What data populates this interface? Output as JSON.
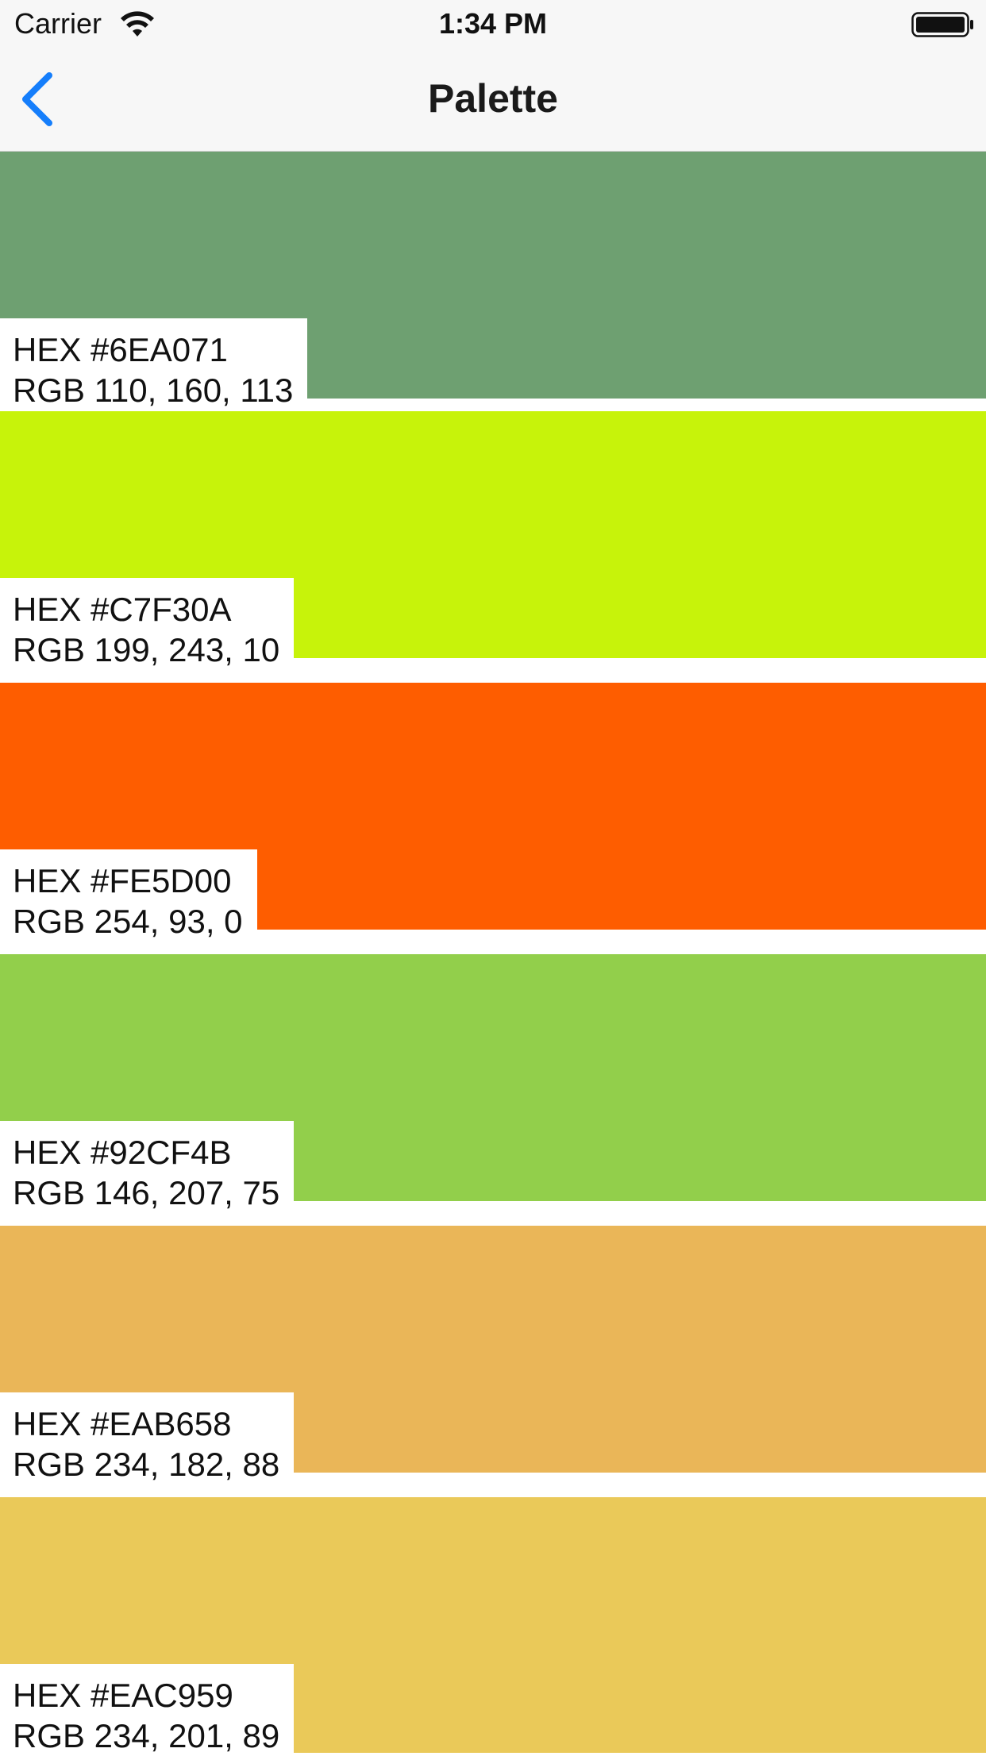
{
  "status_bar": {
    "carrier": "Carrier",
    "time": "1:34 PM",
    "wifi_icon": "wifi-icon",
    "battery_icon": "battery-icon"
  },
  "nav": {
    "title": "Palette",
    "back_icon": "chevron-left-icon",
    "accent_color": "#157efb"
  },
  "colors": [
    {
      "hex_label": "HEX #6EA071",
      "rgb_label": "RGB 110, 160, 113",
      "color": "#6EA071"
    },
    {
      "hex_label": "HEX #C7F30A",
      "rgb_label": "RGB 199, 243, 10",
      "color": "#C7F30A"
    },
    {
      "hex_label": "HEX #FE5D00",
      "rgb_label": "RGB 254, 93, 0",
      "color": "#FE5D00"
    },
    {
      "hex_label": "HEX #92CF4B",
      "rgb_label": "RGB 146, 207, 75",
      "color": "#92CF4B"
    },
    {
      "hex_label": "HEX #EAB658",
      "rgb_label": "RGB 234, 182, 88",
      "color": "#EAB658"
    },
    {
      "hex_label": "HEX #EAC959",
      "rgb_label": "RGB 234, 201, 89",
      "color": "#EAC959"
    }
  ]
}
